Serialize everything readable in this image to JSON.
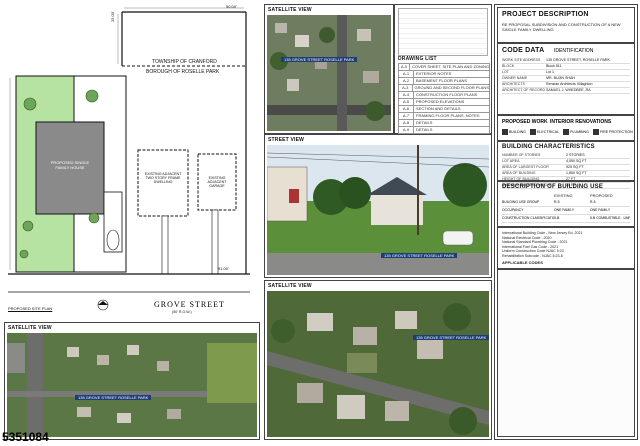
{
  "site_plan": {
    "dim_top": "50.00'",
    "dim_left": "25.00'",
    "dim_bottom": "91.00'",
    "township_label": "TOWNSHIP OF CRANFORD",
    "borough_label": "BOROUGH OF ROSELLE PARK",
    "proposed_house_label": "PROPOSED SINGLE FAMILY HOUSE",
    "existing_dwelling_label": "EXISTING ADJACENT TWO STORY FRAME DWELLING",
    "existing_garage_label": "EXISTING ADJACENT GARAGE",
    "street_name": "GROVE STREET",
    "street_sub": "(50' R.O.W.)",
    "proposed_site_plan_label": "PROPOSED SITE PLAN"
  },
  "drawing_list": {
    "title": "DRAWING LIST",
    "items": [
      {
        "no": "A-0",
        "desc": "COVER SHEET, SITE PLAN AND ZONING"
      },
      {
        "no": "A-1",
        "desc": "EXTERIOR NOTES"
      },
      {
        "no": "A-2",
        "desc": "BASEMENT FLOOR PLANS"
      },
      {
        "no": "A-3",
        "desc": "GROUND AND SECOND FLOOR PLANS"
      },
      {
        "no": "A-4",
        "desc": "CONSTRUCTION FLOOR PLANS"
      },
      {
        "no": "A-5",
        "desc": "PROPOSED ELEVATIONS"
      },
      {
        "no": "A-6",
        "desc": "SECTION AND DETAILS"
      },
      {
        "no": "A-7",
        "desc": "FRAMING FLOOR PLANS, NOTES"
      },
      {
        "no": "A-8",
        "desc": "DETAILS"
      },
      {
        "no": "A-9",
        "desc": "DETAILS"
      },
      {
        "no": "E-1",
        "desc": "ELECTRICAL FLOOR PLANS"
      },
      {
        "no": "E-2",
        "desc": "ELECTRICAL NOTES"
      },
      {
        "no": "M-1",
        "desc": "MECHANICAL FLOOR PLANS, NOTES"
      },
      {
        "no": "P-1",
        "desc": "PLUMBING DIAGRAMS AND NOTES"
      }
    ]
  },
  "satellite_top": {
    "header": "SATELLITE VIEW",
    "tag": "135 GROVE STREET ROSELLE PARK"
  },
  "street_view": {
    "header": "STREET VIEW",
    "tag": "135 GROVE STREET ROSELLE PARK"
  },
  "satellite_mid": {
    "header": "SATELLITE VIEW",
    "tag": "135 GROVE STREET ROSELLE PARK"
  },
  "satellite_bottom": {
    "header": "SATELLITE VIEW",
    "tag": "135 GROVE STREET ROSELLE PARK"
  },
  "project": {
    "header": "PROJECT DESCRIPTION",
    "text": "RE PROPOSAL SUBDIVISION AND CONSTRUCTION OF A NEW SINGLE FAMILY DWELLING"
  },
  "code_data": {
    "header": "CODE DATA",
    "sub": "IDENTIFICATION",
    "rows": [
      {
        "k": "WORK SITE ADDRESS",
        "v": "135 GROVE STREET, ROSELLE PARK"
      },
      {
        "k": "BLOCK",
        "v": "Block 511"
      },
      {
        "k": "LOT",
        "v": "Lot 1"
      },
      {
        "k": "OWNER NAME",
        "v": "MR. BUJIN SHAH"
      },
      {
        "k": "ARCHITECTS",
        "v": "Renzian Architects Villaghton"
      },
      {
        "k": "ARCHITECT OF RECORD",
        "v": "SAMUEL J. WHEDBEE, RA"
      }
    ]
  },
  "renovations": {
    "header": "PROPOSED WORK",
    "sub": "INTERIOR RENOVATIONS",
    "items": [
      "BUILDING",
      "ELECTRICAL",
      "PLUMBING",
      "FIRE PROTECTION"
    ]
  },
  "building_chars": {
    "header": "BUILDING CHARACTERISTICS",
    "rows": [
      {
        "k": "NUMBER OF STORIES",
        "v": "2 STORIES"
      },
      {
        "k": "LOT AREA",
        "v": "4,550 SQ FT"
      },
      {
        "k": "AREA OF LARGEST FLOOR",
        "v": "925 SQ FT"
      },
      {
        "k": "AREA OF BUILDING",
        "v": "1,850 SQ FT"
      },
      {
        "k": "HEIGHT OF BUILDING",
        "v": "27 FT"
      },
      {
        "k": "MAXIMUM BUILDING HEIGHT",
        "v": "35 FT"
      }
    ]
  },
  "use_description": {
    "header": "DESCRIPTION OF BUILDING USE",
    "col_existing": "EXISTING",
    "col_proposed": "PROPOSED",
    "rows": [
      {
        "k": "BUILDING USE GROUP",
        "a": "R-5",
        "b": "R-5"
      },
      {
        "k": "OCCUPANCY",
        "a": "ONE FAMILY",
        "b": "ONE FAMILY"
      },
      {
        "k": "CONSTRUCTION CLASSIFICATION",
        "a": "5-B",
        "b": "5-B COMBUSTIBLE - UNPROTECTED"
      }
    ]
  },
  "codes": {
    "lines": [
      "International Building Code - New Jersey Ed. 2021",
      "National Electrical Code - 2020",
      "National Standard Plumbing Code - 2021",
      "International Fuel Gas Code - 2021",
      "Uniform Construction Code NJAC 5:23",
      "Rehabilitation Subcode - NJAC 5:23-6"
    ],
    "footer": "APPLICABLE CODES"
  },
  "watermark": "5351084",
  "colors": {
    "accent": "#1d3d75",
    "green": "#b7e3a2",
    "grass": "#5b8f3a"
  }
}
